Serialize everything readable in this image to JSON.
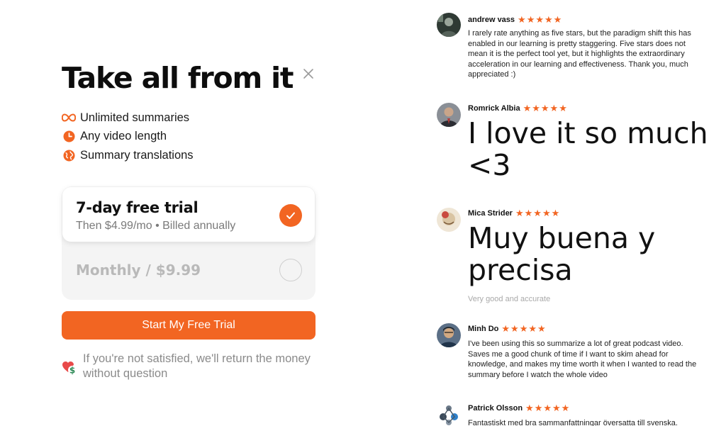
{
  "modal": {
    "title": "Take all from it",
    "features": [
      {
        "icon": "infinity-icon",
        "label": "Unlimited summaries"
      },
      {
        "icon": "clock-icon",
        "label": "Any video length"
      },
      {
        "icon": "globe-icon",
        "label": "Summary translations"
      }
    ],
    "plans": {
      "selected": {
        "name": "7-day free trial",
        "subtitle": "Then $4.99/mo • Billed annually"
      },
      "other": {
        "name": "Monthly / $9.99"
      }
    },
    "cta_label": "Start My Free Trial",
    "guarantee": "If you're not satisfied, we'll return the money without question",
    "accent_color": "#f26522"
  },
  "reviews": [
    {
      "name": "andrew vass",
      "stars": 5,
      "text": "I rarely rate anything as five stars, but the paradigm shift this has enabled in our learning is pretty staggering. Five stars does not mean it is the perfect tool yet, but it highlights the extraordinary acceleration in our learning and effectiveness. Thank you, much appreciated :)"
    },
    {
      "name": "Romrick Albia",
      "stars": 5,
      "text": "I love it so much <3"
    },
    {
      "name": "Mica Strider",
      "stars": 5,
      "text": "Muy buena y precisa",
      "translation": "Very good and accurate"
    },
    {
      "name": "Minh Do",
      "stars": 5,
      "text": "I've been using this so summarize a lot of great podcast video. Saves me a good chunk of time if I want to skim ahead for knowledge, and makes my time worth it when I wanted to read the summary before I watch the whole video"
    },
    {
      "name": "Patrick Olsson",
      "stars": 5,
      "text": "Fantastiskt med bra sammanfattningar översatta till svenska."
    }
  ]
}
